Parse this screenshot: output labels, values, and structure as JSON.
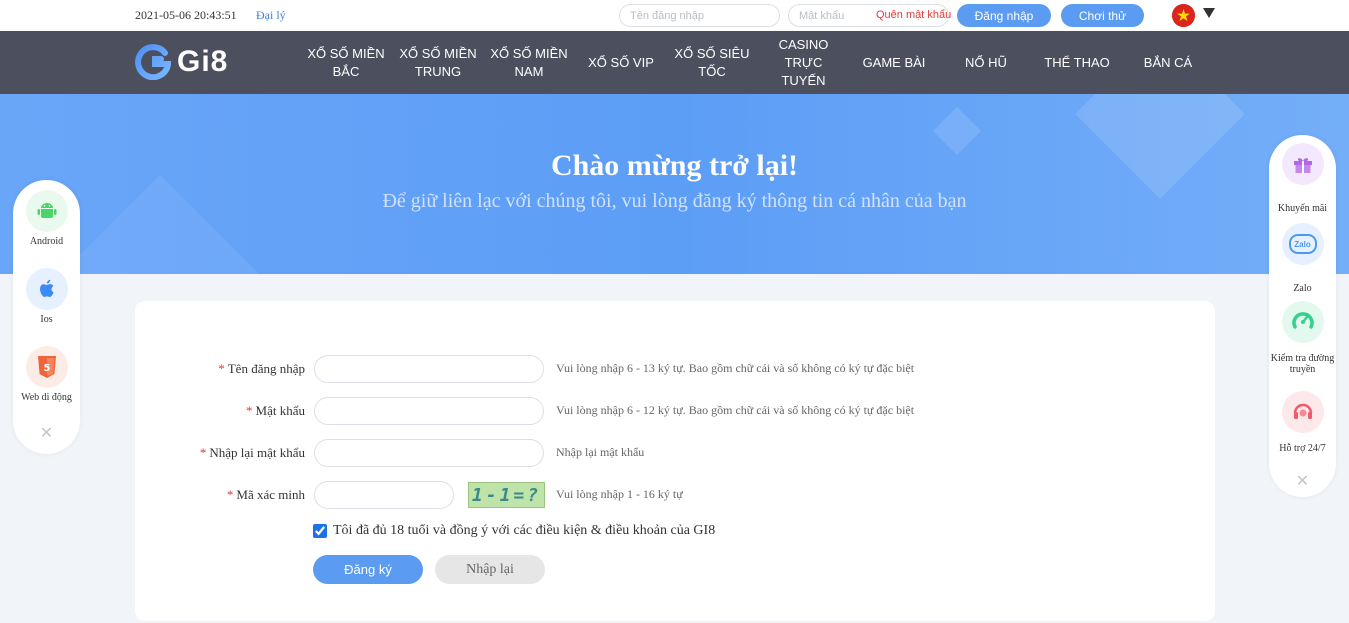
{
  "topbar": {
    "datetime": "2021-05-06 20:43:51",
    "agent_link": "Đại lý",
    "username_placeholder": "Tên đăng nhập",
    "password_placeholder": "Mật khẩu",
    "forgot_password": "Quên mật khẩu",
    "login_button": "Đăng nhập",
    "trial_button": "Chơi thử"
  },
  "logo": {
    "text": "Gi8"
  },
  "nav": {
    "items": [
      "XỔ SỐ MIỀN BẮC",
      "XỔ SỐ MIỀN TRUNG",
      "XỔ SỐ MIỀN NAM",
      "XỔ SỐ VIP",
      "XỔ SỐ SIÊU TỐC",
      "CASINO TRỰC TUYẾN",
      "GAME BÀI",
      "NỔ HŨ",
      "THỂ THAO",
      "BẮN CÁ"
    ]
  },
  "banner": {
    "title": "Chào mừng trở lại!",
    "subtitle": "Để giữ liên lạc với chúng tôi, vui lòng đăng ký thông tin cá nhân của bạn"
  },
  "form": {
    "required_mark": "*",
    "username_label": "Tên đăng nhập",
    "username_hint": "Vui lòng nhập 6 - 13 ký tự. Bao gồm chữ cái và số không có ký tự đặc biệt",
    "password_label": "Mật khẩu",
    "password_hint": "Vui lòng nhập 6 - 12 ký tự. Bao gồm chữ cái và số không có ký tự đặc biệt",
    "confirm_label": "Nhập lại mật khẩu",
    "confirm_hint": "Nhập lại mật khẩu",
    "captcha_label": "Mã xác minh",
    "captcha_text": "1-1=?",
    "captcha_hint": "Vui lòng nhập 1 - 16 ký tự",
    "agree_text": "Tôi đã đủ 18 tuổi và đồng ý với các điều kiện & điều khoản của GI8",
    "submit_button": "Đăng ký",
    "reset_button": "Nhập lại"
  },
  "left_panel": {
    "items": [
      {
        "label": "Android",
        "icon": "android-icon",
        "color": "#4cd36a"
      },
      {
        "label": "Ios",
        "icon": "apple-icon",
        "color": "#3d8cf5"
      },
      {
        "label": "Web di động",
        "icon": "html5-icon",
        "color": "#f0643a"
      }
    ],
    "close": "✕"
  },
  "right_panel": {
    "items": [
      {
        "label": "Khuyến mãi",
        "icon": "gift-icon",
        "color": "#b266e8"
      },
      {
        "label": "Zalo",
        "icon": "zalo-icon",
        "color": "#4a9af5",
        "badge": "Zalo"
      },
      {
        "label": "Kiểm tra đường truyền",
        "icon": "speed-test-icon",
        "color": "#35d08a"
      },
      {
        "label": "Hỗ trợ 24/7",
        "icon": "support-icon",
        "color": "#f05a6a"
      }
    ],
    "close": "✕"
  },
  "colors": {
    "primary": "#5b9bf2",
    "nav_bg": "#4b4f5e",
    "required": "#e53935"
  }
}
